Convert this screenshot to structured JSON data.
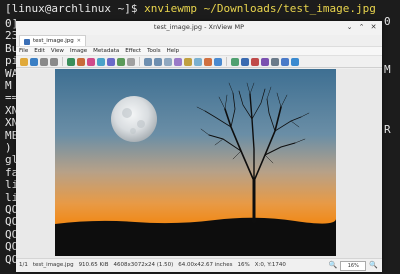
{
  "terminal": {
    "prompt": "[linux@archlinux ~]$",
    "command": "xnviewmp ~/Downloads/test_image.jpg",
    "left_fragments": [
      "0]",
      "23",
      "Bu",
      "pi",
      "WA",
      "M",
      "==",
      "XN",
      "XN",
      "ME",
      ")",
      "gl",
      "fa",
      "li",
      "li",
      "QO",
      "QO",
      "QO",
      "QO",
      "QO"
    ],
    "right_fragments": [
      "0",
      "M",
      "R"
    ]
  },
  "window": {
    "title": "test_image.jpg - XnView MP",
    "tab_label": "test_image.jpg",
    "menu": [
      "File",
      "Edit",
      "View",
      "Image",
      "Metadata",
      "Effect",
      "Tools",
      "Help"
    ]
  },
  "toolbar_icons": [
    "folder-icon",
    "settings-icon",
    "back-icon",
    "forward-icon",
    "save-icon",
    "crop-icon",
    "color-icon",
    "image-icon",
    "palette-icon",
    "resize-icon",
    "rotate-icon",
    "zoom-in-icon",
    "zoom-out-icon",
    "fit-icon",
    "flip-icon",
    "adjust-icon",
    "sharpen-icon",
    "levels-icon",
    "slideshow-icon",
    "compare-icon",
    "fullscreen-icon",
    "brush-icon",
    "filter-icon",
    "print-icon",
    "info-icon",
    "help-icon"
  ],
  "status": {
    "index": "1/1",
    "filename": "test_image.jpg",
    "filesize": "910.65 KiB",
    "dimensions": "4608x3072x24 (1.50)",
    "print_size": "64.00x42.67 inches",
    "zoom_pct": "16%",
    "coords": "X:0, Y:1740",
    "zoom_value": "16%"
  },
  "colors": {
    "terminal_bg": "#1c1c1c",
    "command": "#e8d44d",
    "sky_top": "#3e6f92",
    "sky_horizon": "#f08a1a"
  }
}
